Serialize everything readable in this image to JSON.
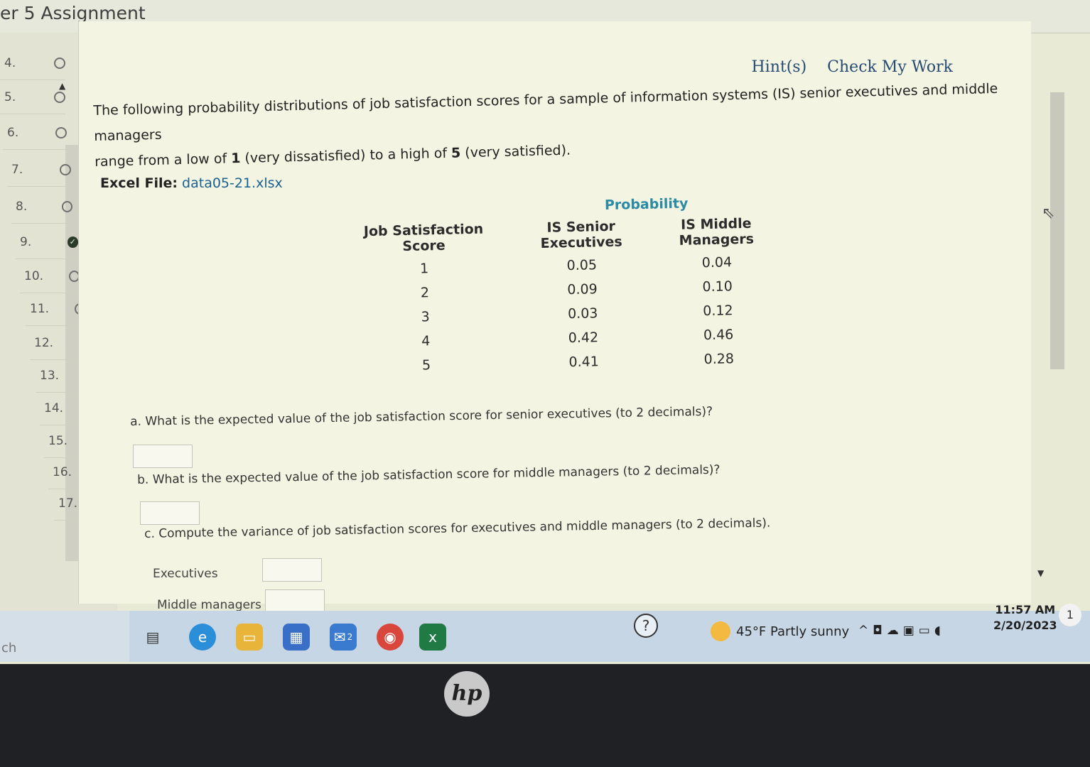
{
  "app": {
    "title": "er 5 Assignment"
  },
  "sidebar": {
    "items": [
      {
        "num": "4.",
        "status": "empty"
      },
      {
        "num": "5.",
        "status": "empty"
      },
      {
        "num": "6.",
        "status": "empty"
      },
      {
        "num": "7.",
        "status": "empty"
      },
      {
        "num": "8.",
        "status": "empty"
      },
      {
        "num": "9.",
        "status": "done"
      },
      {
        "num": "10.",
        "status": "empty"
      },
      {
        "num": "11.",
        "status": "empty"
      },
      {
        "num": "12.",
        "status": "empty"
      },
      {
        "num": "13.",
        "status": "empty"
      },
      {
        "num": "14.",
        "status": "empty"
      },
      {
        "num": "15.",
        "status": "empty"
      },
      {
        "num": "16.",
        "status": "empty"
      },
      {
        "num": "17.",
        "status": "empty"
      }
    ]
  },
  "header": {
    "hints_label": "Hint(s)",
    "check_label": "Check My Work"
  },
  "problem": {
    "intro_1": "The following probability distributions of job satisfaction scores for a sample of information systems (IS) senior executives and middle managers",
    "intro_2a": "range from a low of ",
    "intro_low": "1",
    "intro_2b": " (very dissatisfied) to a high of ",
    "intro_high": "5",
    "intro_2c": " (very satisfied).",
    "excel_label": "Excel File:",
    "excel_file": "data05-21.xlsx"
  },
  "table": {
    "group_header": "Probability",
    "col1_line1": "Job Satisfaction",
    "col1_line2": "Score",
    "col2_line1": "IS Senior",
    "col2_line2": "Executives",
    "col3_line1": "IS Middle",
    "col3_line2": "Managers",
    "rows": [
      {
        "score": "1",
        "senior": "0.05",
        "middle": "0.04"
      },
      {
        "score": "2",
        "senior": "0.09",
        "middle": "0.10"
      },
      {
        "score": "3",
        "senior": "0.03",
        "middle": "0.12"
      },
      {
        "score": "4",
        "senior": "0.42",
        "middle": "0.46"
      },
      {
        "score": "5",
        "senior": "0.41",
        "middle": "0.28"
      }
    ]
  },
  "questions": {
    "a": "a. What is the expected value of the job satisfaction score for senior executives (to 2 decimals)?",
    "b": "b. What is the expected value of the job satisfaction score for middle managers (to 2 decimals)?",
    "c": "c. Compute the variance of job satisfaction scores for executives and middle managers (to 2 decimals).",
    "executives_label": "Executives",
    "middle_label": "Middle managers"
  },
  "taskbar": {
    "search_text": "ch",
    "mail_badge": "2",
    "weather": "45°F  Partly sunny",
    "time": "11:57 AM",
    "date": "2/20/2023",
    "notifications": "1"
  },
  "device": {
    "logo": "hp"
  }
}
